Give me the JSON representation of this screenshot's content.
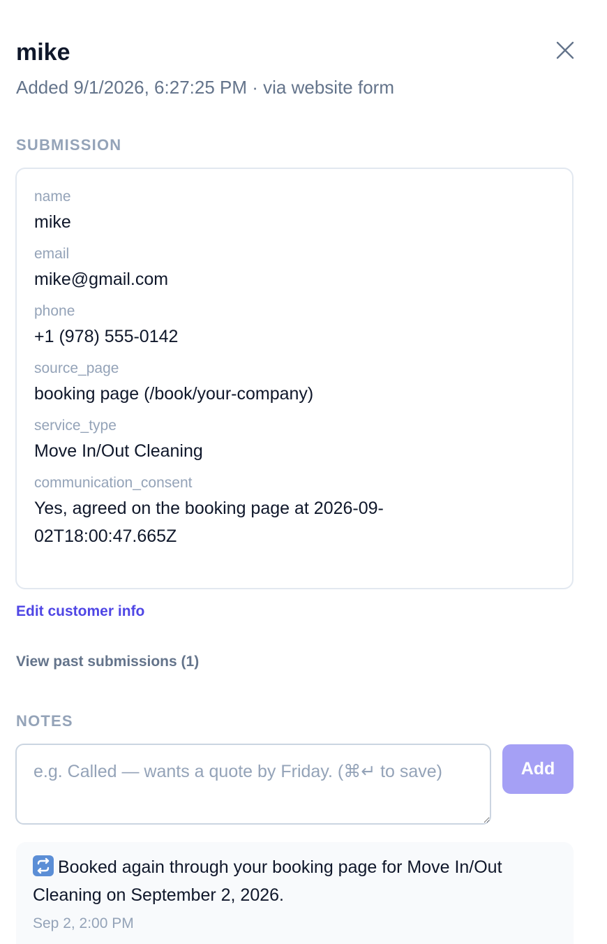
{
  "header": {
    "title": "mike",
    "subtitle": "Added 9/1/2026, 6:27:25 PM · via website form",
    "close_icon": "close-icon"
  },
  "submission": {
    "heading": "SUBMISSION",
    "fields": [
      {
        "label": "name",
        "value": "mike"
      },
      {
        "label": "email",
        "value": "mike@gmail.com"
      },
      {
        "label": "phone",
        "value": "+1 (978) 555-0142"
      },
      {
        "label": "source_page",
        "value": "booking page (/book/your-company)"
      },
      {
        "label": "service_type",
        "value": "Move In/Out Cleaning"
      },
      {
        "label": "communication_consent",
        "value": "Yes, agreed on the booking page at 2026-09-02T18:00:47.665Z"
      }
    ]
  },
  "links": {
    "edit_customer": "Edit customer info",
    "past_submissions": "View past submissions (1)"
  },
  "notes": {
    "heading": "NOTES",
    "input_value": "",
    "input_placeholder": "e.g. Called — wants a quote by Friday. (⌘↵ to save)",
    "add_label": "Add",
    "add_button_color": "#a5a0f5",
    "items": [
      {
        "icon": "repeat-icon",
        "text": "Booked again through your booking page for Move In/Out Cleaning on September 2, 2026.",
        "time": "Sep 2, 2:00 PM"
      }
    ]
  },
  "colors": {
    "accent_link": "#4f46e5",
    "muted": "#94a3b8",
    "subtle": "#64748b"
  }
}
